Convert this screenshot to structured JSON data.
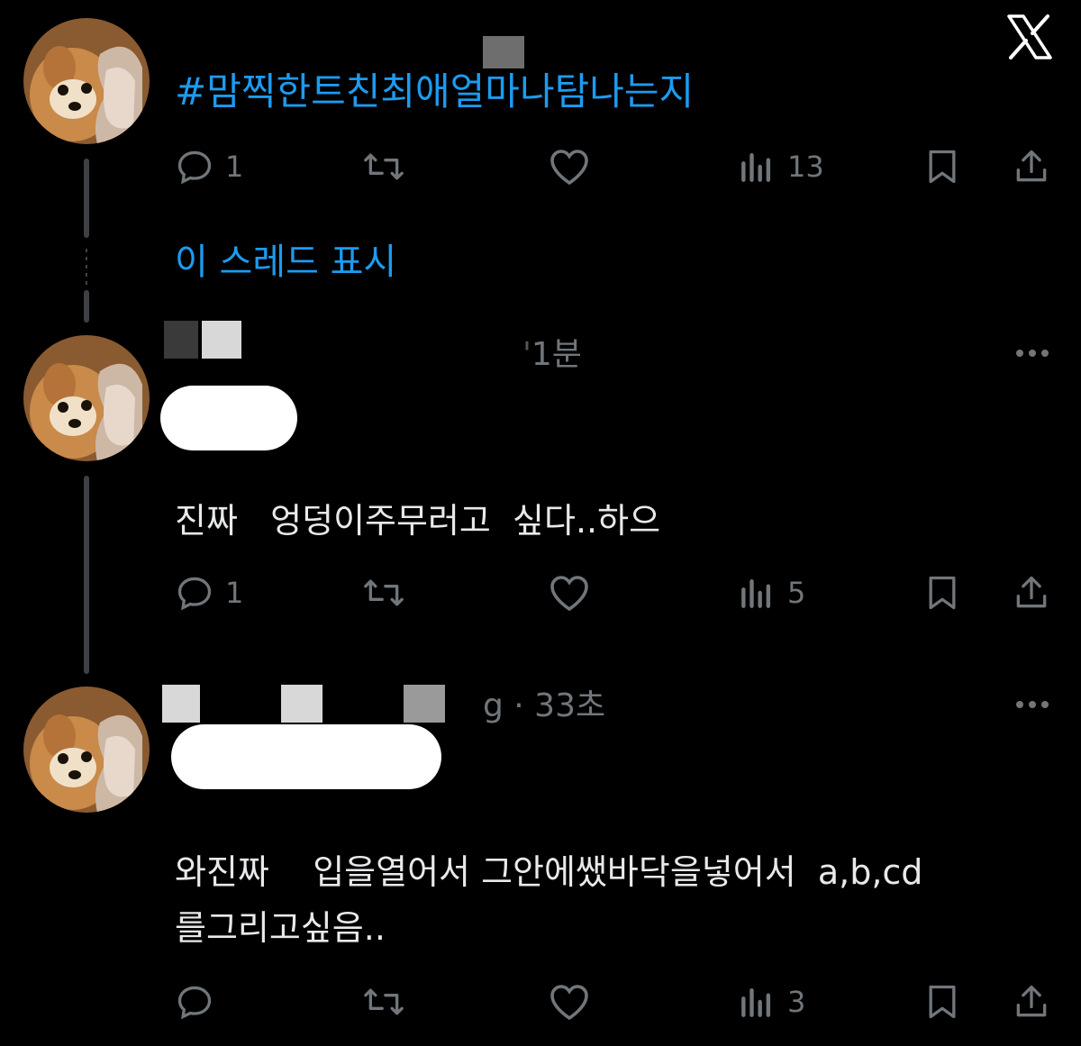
{
  "app": {
    "logo": "x-logo"
  },
  "tweets": [
    {
      "text": "#맘찍한트친최애얼마나탐나는지",
      "actions": {
        "reply_count": "1",
        "retweet_count": "",
        "like_count": "",
        "views_count": "13"
      }
    },
    {
      "time": "1분",
      "text": "진짜   엉덩이주무러고  싶다..하으",
      "actions": {
        "reply_count": "1",
        "retweet_count": "",
        "like_count": "",
        "views_count": "5"
      }
    },
    {
      "time": "g · 33초",
      "text_line1": "와진짜    입을열어서 그안에쌨바닥을넣어서  a,b,cd",
      "text_line2": "를그리고싶음..",
      "actions": {
        "reply_count": "",
        "retweet_count": "",
        "like_count": "",
        "views_count": "3"
      }
    }
  ],
  "thread": {
    "show_thread_label": "이 스레드 표시"
  },
  "icons": [
    "reply-icon",
    "retweet-icon",
    "like-icon",
    "views-icon",
    "bookmark-icon",
    "share-icon",
    "more-icon"
  ],
  "colors": {
    "background": "#000000",
    "link": "#1d9bf0",
    "text": "#e7e9ea",
    "muted": "#71767b"
  }
}
